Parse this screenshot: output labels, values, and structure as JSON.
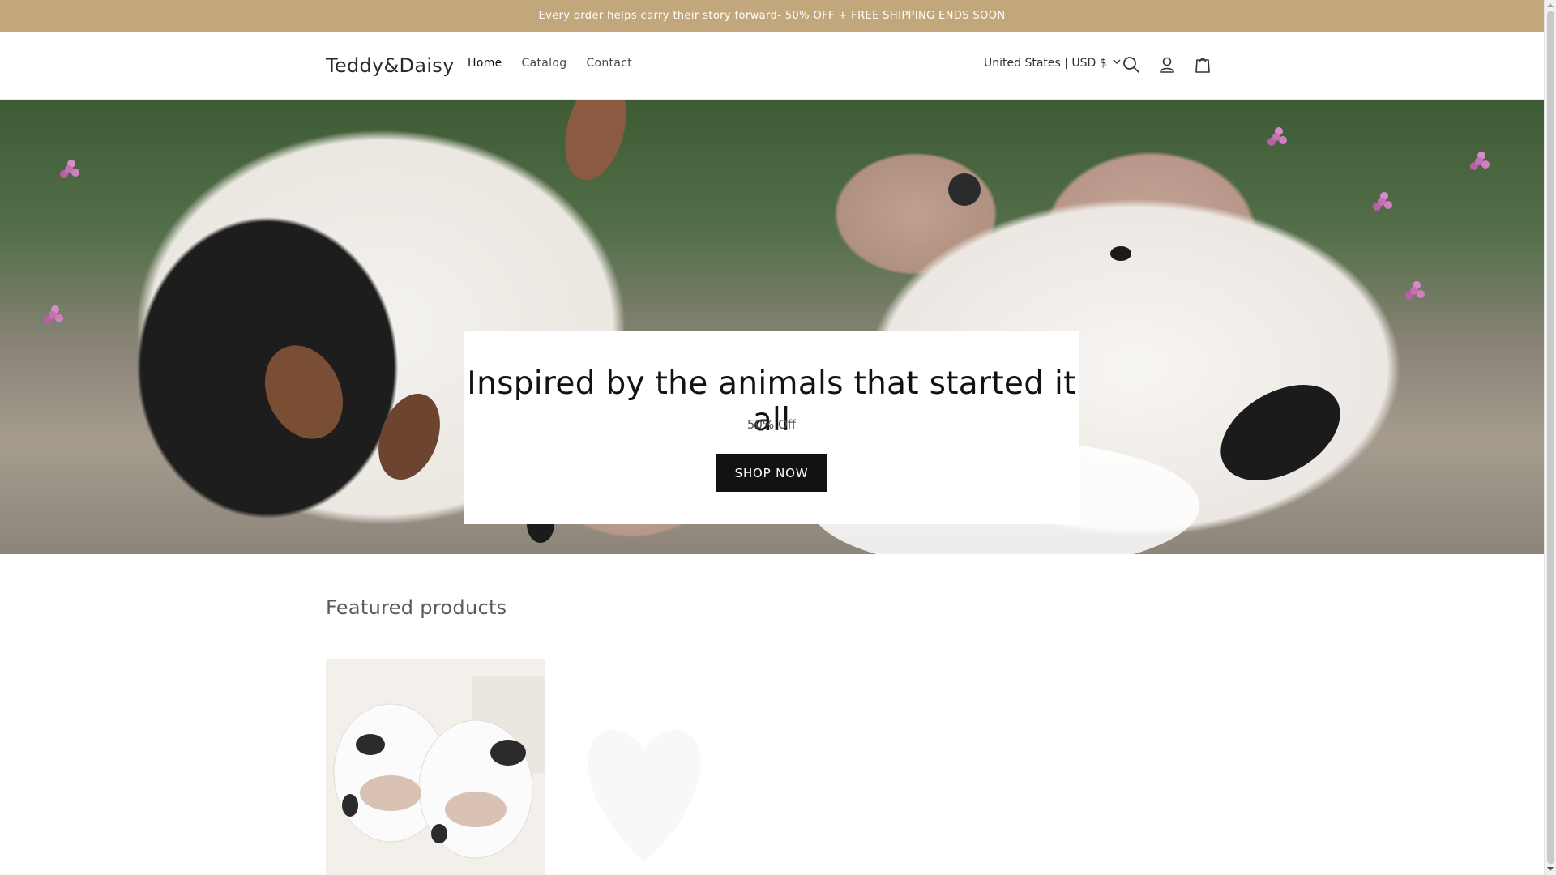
{
  "announcement": {
    "text": "Every order helps carry their story forward- 50% OFF + FREE SHIPPING ENDS SOON"
  },
  "header": {
    "logo": "Teddy&Daisy",
    "nav": [
      {
        "label": "Home",
        "active": true
      },
      {
        "label": "Catalog",
        "active": false
      },
      {
        "label": "Contact",
        "active": false
      }
    ],
    "locale": "United States | USD $",
    "icons": [
      "search-icon",
      "account-icon",
      "cart-icon"
    ]
  },
  "hero": {
    "title": "Inspired by the animals that started it all",
    "subtitle": "50% Off",
    "button": "SHOP NOW"
  },
  "featured": {
    "title": "Featured products"
  },
  "colors": {
    "announcement_bg": "#c3a77c",
    "button_bg": "#121212",
    "text": "#121212"
  }
}
